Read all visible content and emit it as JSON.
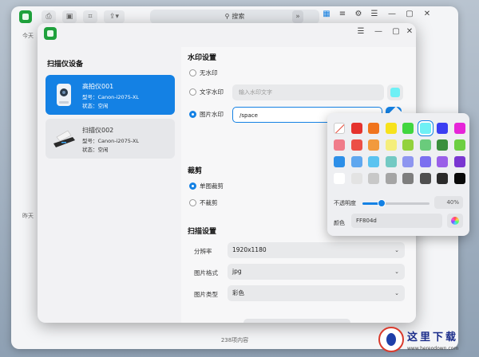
{
  "background_window": {
    "search_placeholder": "搜索",
    "date_today": "今天",
    "date_yesterday": "昨天",
    "footer_count": "238项内容"
  },
  "left_panel": {
    "title": "扫描仪设备",
    "devices": [
      {
        "name": "高拍仪001",
        "model": "型号：Canon-i2075-XL",
        "status": "状态：空闲",
        "selected": true
      },
      {
        "name": "扫描仪002",
        "model": "型号：Canon-i2075-XL",
        "status": "状态：空闲",
        "selected": false
      }
    ]
  },
  "watermark_section": {
    "title": "水印设置",
    "options": [
      {
        "label": "无水印",
        "selected": false
      },
      {
        "label": "文字水印",
        "selected": false
      },
      {
        "label": "图片水印",
        "selected": true
      }
    ],
    "text_placeholder": "输入水印文字",
    "image_path": "/space"
  },
  "crop_section": {
    "title": "裁剪",
    "options": [
      {
        "label": "单图裁剪",
        "selected": true
      },
      {
        "label": "不裁剪",
        "selected": false
      }
    ]
  },
  "scan_section": {
    "title": "扫描设置",
    "fields": [
      {
        "label": "分辨率",
        "value": "1920x1180"
      },
      {
        "label": "图片格式",
        "value": "jpg"
      },
      {
        "label": "图片类型",
        "value": "彩色"
      }
    ],
    "start_label": "开 始"
  },
  "color_picker": {
    "colors": [
      "none",
      "#e5322d",
      "#f0731c",
      "#f7e21c",
      "#41d63f",
      "#6ef0f5",
      "#3b3ef2",
      "#e625d8",
      "#f07c8a",
      "#ec4f46",
      "#f29a3d",
      "#f5ee7c",
      "#93d23d",
      "#6acb7c",
      "#3a8f3c",
      "#6dcf42",
      "#2d8fe8",
      "#5fa7ef",
      "#5bc3f0",
      "#73c9c3",
      "#8e96f0",
      "#7b6ff0",
      "#9a5fe8",
      "#7a36d1",
      "#ffffff",
      "#e3e3e3",
      "#c8c8c8",
      "#a5a5a5",
      "#7e7e7e",
      "#4f4f4f",
      "#2b2b2b",
      "#0a0a0a"
    ],
    "selected_index": 5,
    "opacity_label": "不透明度",
    "opacity_value": "40%",
    "opacity_fraction": 0.28,
    "hex_label": "颜色",
    "hex_value": "FF804d"
  },
  "site_watermark": {
    "title": "这里下载",
    "url": "www.hereodown.com"
  },
  "accent_color": "#1481e4"
}
